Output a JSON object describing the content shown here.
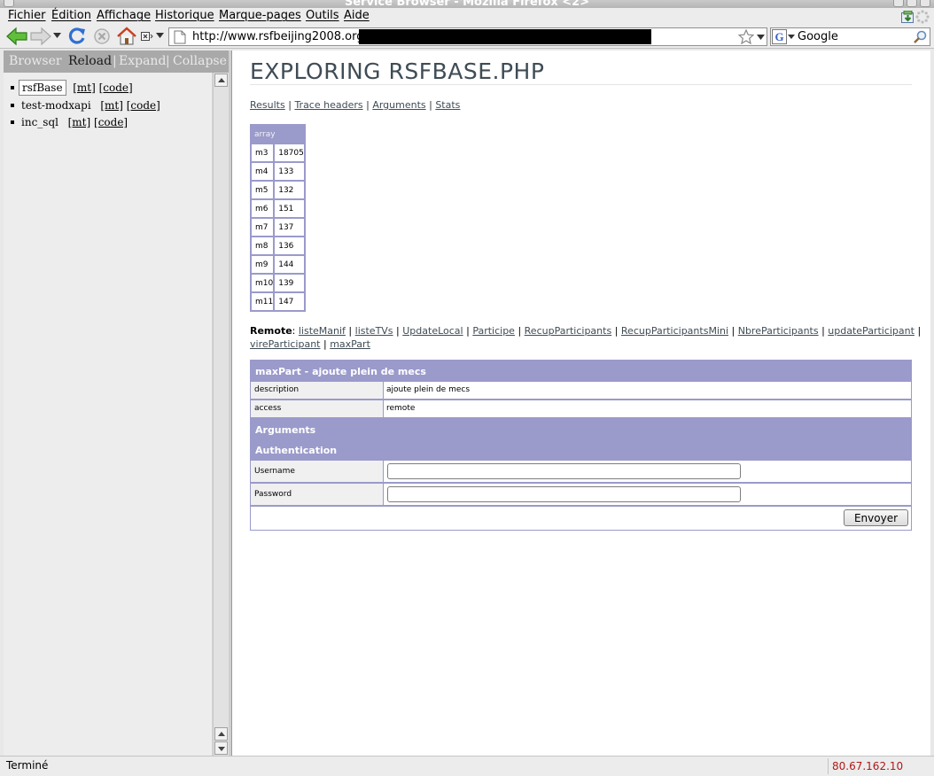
{
  "window": {
    "title": "Service Browser - Mozilla Firefox <2>"
  },
  "menu": [
    "Fichier",
    "Édition",
    "Affichage",
    "Historique",
    "Marque-pages",
    "Outils",
    "Aide"
  ],
  "nav": {
    "url": "http://www.rsfbeijing2008.org/",
    "search_placeholder": "Google"
  },
  "sidebar": {
    "header": {
      "title": "Browser",
      "reload": "Reload",
      "sep1": "|",
      "expand": "Expand",
      "sep2": "|",
      "collapse": "Collapse"
    },
    "items": [
      {
        "name": "rsfBase",
        "mt": "[mt]",
        "code": "[code]"
      },
      {
        "name": "test-modxapi",
        "mt": "[mt]",
        "code": "[code]"
      },
      {
        "name": "inc_sql",
        "mt": "[mt]",
        "code": "[code]"
      }
    ]
  },
  "main": {
    "title": "EXPLORING RSFBASE.PHP",
    "links": [
      "Results",
      "Trace headers",
      "Arguments",
      "Stats"
    ],
    "array": {
      "header": "array",
      "rows": [
        [
          "m3",
          "18705"
        ],
        [
          "m4",
          "133"
        ],
        [
          "m5",
          "132"
        ],
        [
          "m6",
          "151"
        ],
        [
          "m7",
          "137"
        ],
        [
          "m8",
          "136"
        ],
        [
          "m9",
          "144"
        ],
        [
          "m10",
          "139"
        ],
        [
          "m11",
          "147"
        ]
      ]
    },
    "remote": {
      "label": "Remote",
      "methods": [
        "listeManif",
        "listeTVs",
        "UpdateLocal",
        "Participe",
        "RecupParticipants",
        "RecupParticipantsMini",
        "NbreParticipants",
        "updateParticipant",
        "vireParticipant",
        "maxPart"
      ]
    },
    "method": {
      "title": "maxPart - ajoute plein de mecs",
      "description_label": "description",
      "description_value": "ajoute plein de mecs",
      "access_label": "access",
      "access_value": "remote",
      "arguments_label": "Arguments",
      "auth_label": "Authentication",
      "username_label": "Username",
      "password_label": "Password",
      "submit_label": "Envoyer"
    }
  },
  "status": {
    "text": "Terminé",
    "ip": "80.67.162.10"
  },
  "colors": {
    "accent": "#9a9acb",
    "sidebar_head": "#a9a9a9",
    "ip": "#b01818"
  }
}
